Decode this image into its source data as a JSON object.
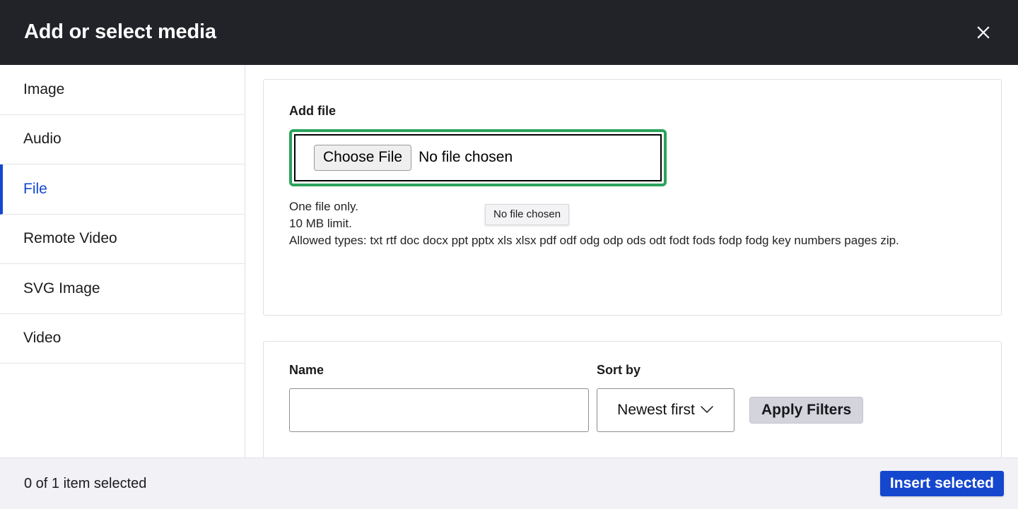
{
  "header": {
    "title": "Add or select media",
    "close_icon": "close-icon",
    "background": "#212329"
  },
  "sidebar": {
    "items": [
      {
        "label": "Image",
        "active": false
      },
      {
        "label": "Audio",
        "active": false
      },
      {
        "label": "File",
        "active": true
      },
      {
        "label": "Remote Video",
        "active": false
      },
      {
        "label": "SVG Image",
        "active": false
      },
      {
        "label": "Video",
        "active": false
      }
    ],
    "active_color": "#1148cf"
  },
  "upload": {
    "label": "Add file",
    "choose_file_label": "Choose File",
    "file_status": "No file chosen",
    "focus_ring_color": "#2aa35c",
    "description": {
      "line1": "One file only.",
      "line2": "10 MB limit.",
      "line3": "Allowed types: txt rtf doc docx ppt pptx xls xlsx pdf odf odg odp ods odt fodt fods fodp fodg key numbers pages zip."
    }
  },
  "tooltip": {
    "text": "No file chosen"
  },
  "filters": {
    "name_label": "Name",
    "name_value": "",
    "name_placeholder": "",
    "sort_label": "Sort by",
    "sort_value": "Newest first",
    "sort_chevron_icon": "chevron-down-icon",
    "apply_label": "Apply Filters"
  },
  "footer": {
    "selected_text": "0 of 1 item selected",
    "insert_label": "Insert selected",
    "insert_color": "#1546ce",
    "background": "#f1f1f6"
  }
}
